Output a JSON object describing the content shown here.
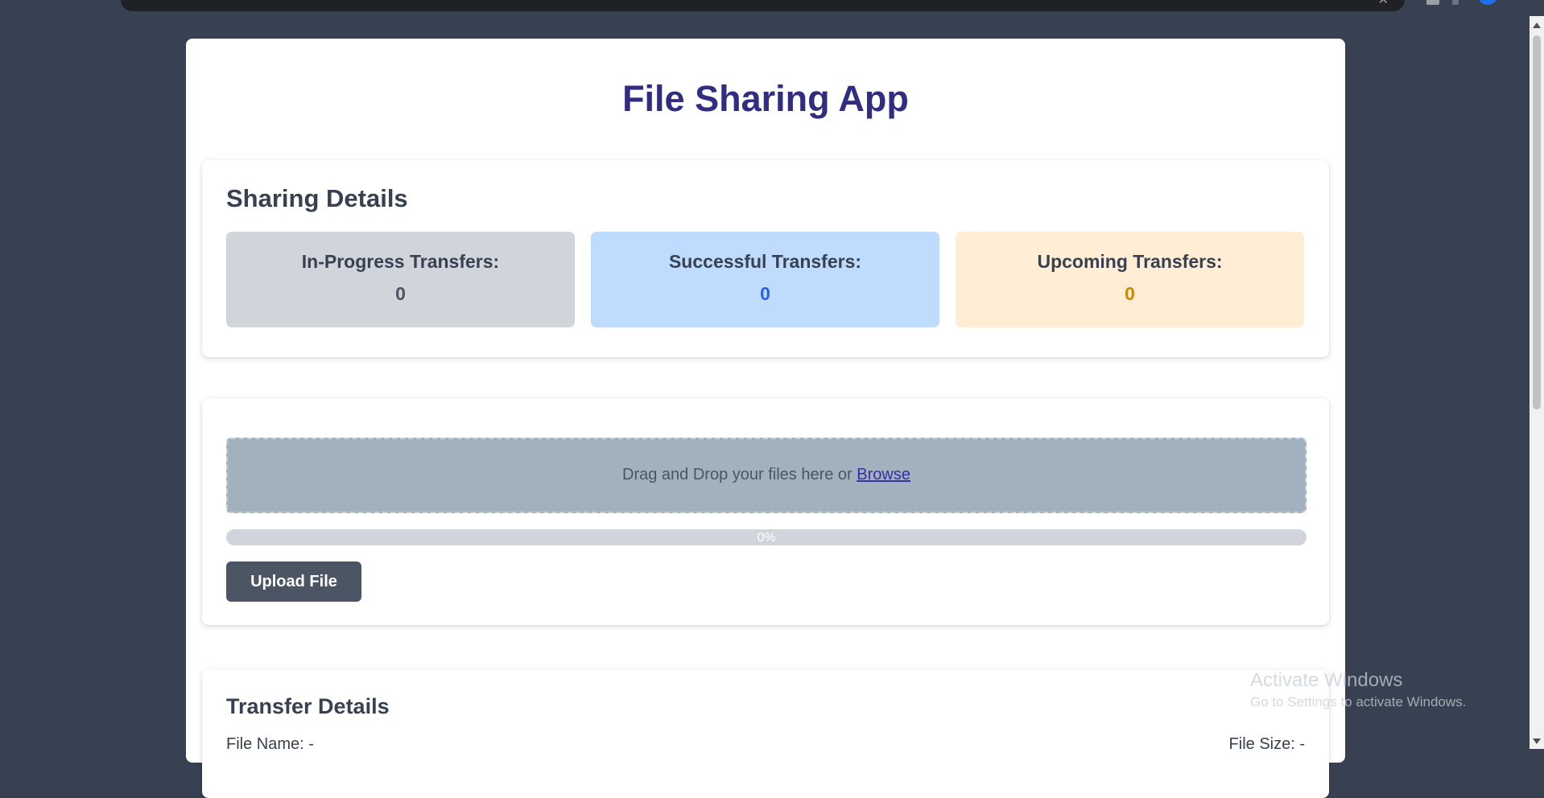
{
  "app": {
    "title": "File Sharing App"
  },
  "sharing": {
    "heading": "Sharing Details",
    "stats": [
      {
        "label": "In-Progress Transfers:",
        "value": "0",
        "color": "#4b5563"
      },
      {
        "label": "Successful Transfers:",
        "value": "0",
        "color": "#2563eb"
      },
      {
        "label": "Upcoming Transfers:",
        "value": "0",
        "color": "#ca8a04"
      }
    ]
  },
  "upload": {
    "dropzone_text": "Drag and Drop your files here or",
    "browse_label": "Browse",
    "progress": {
      "percent": 0,
      "text": "0%"
    },
    "button_label": "Upload File"
  },
  "transfer": {
    "heading": "Transfer Details",
    "file_name_label": "File Name: -",
    "file_size_label": "File Size: -"
  },
  "watermark": {
    "title": "Activate Windows",
    "subtitle": "Go to Settings to activate Windows."
  },
  "colors": {
    "background": "#374151",
    "title": "#312e81",
    "button": "#4b5563",
    "browse_link": "#3730a3"
  }
}
